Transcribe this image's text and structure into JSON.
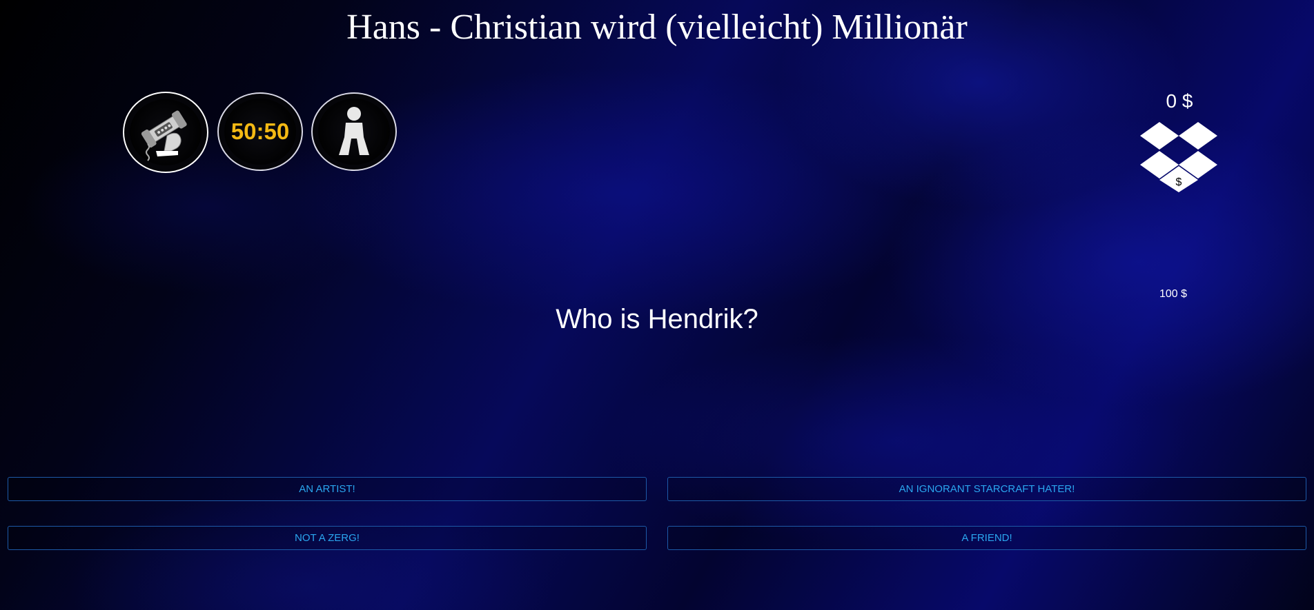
{
  "game": {
    "title": "Hans - Christian wird (vielleicht) Millionär"
  },
  "lifelines": [
    {
      "name": "phone-a-friend",
      "icon": "hand-holding-phone-icon"
    },
    {
      "name": "fifty-fifty",
      "label": "50:50",
      "color": "#f4b914"
    },
    {
      "name": "ask-the-audience",
      "icon": "person-icon"
    }
  ],
  "money": {
    "current": "0 $",
    "icon": "dropbox-money-icon",
    "icon_symbol": "$",
    "next": "100 $"
  },
  "question": {
    "text": "Who is Hendrik?"
  },
  "answers": [
    {
      "label": "AN ARTIST!"
    },
    {
      "label": "AN IGNORANT STARCRAFT HATER!"
    },
    {
      "label": "NOT A ZERG!"
    },
    {
      "label": "A FRIEND!"
    }
  ],
  "colors": {
    "answer_text": "#2aa6ef",
    "answer_border": "#1d5aa8",
    "fifty_text": "#f4b914"
  }
}
